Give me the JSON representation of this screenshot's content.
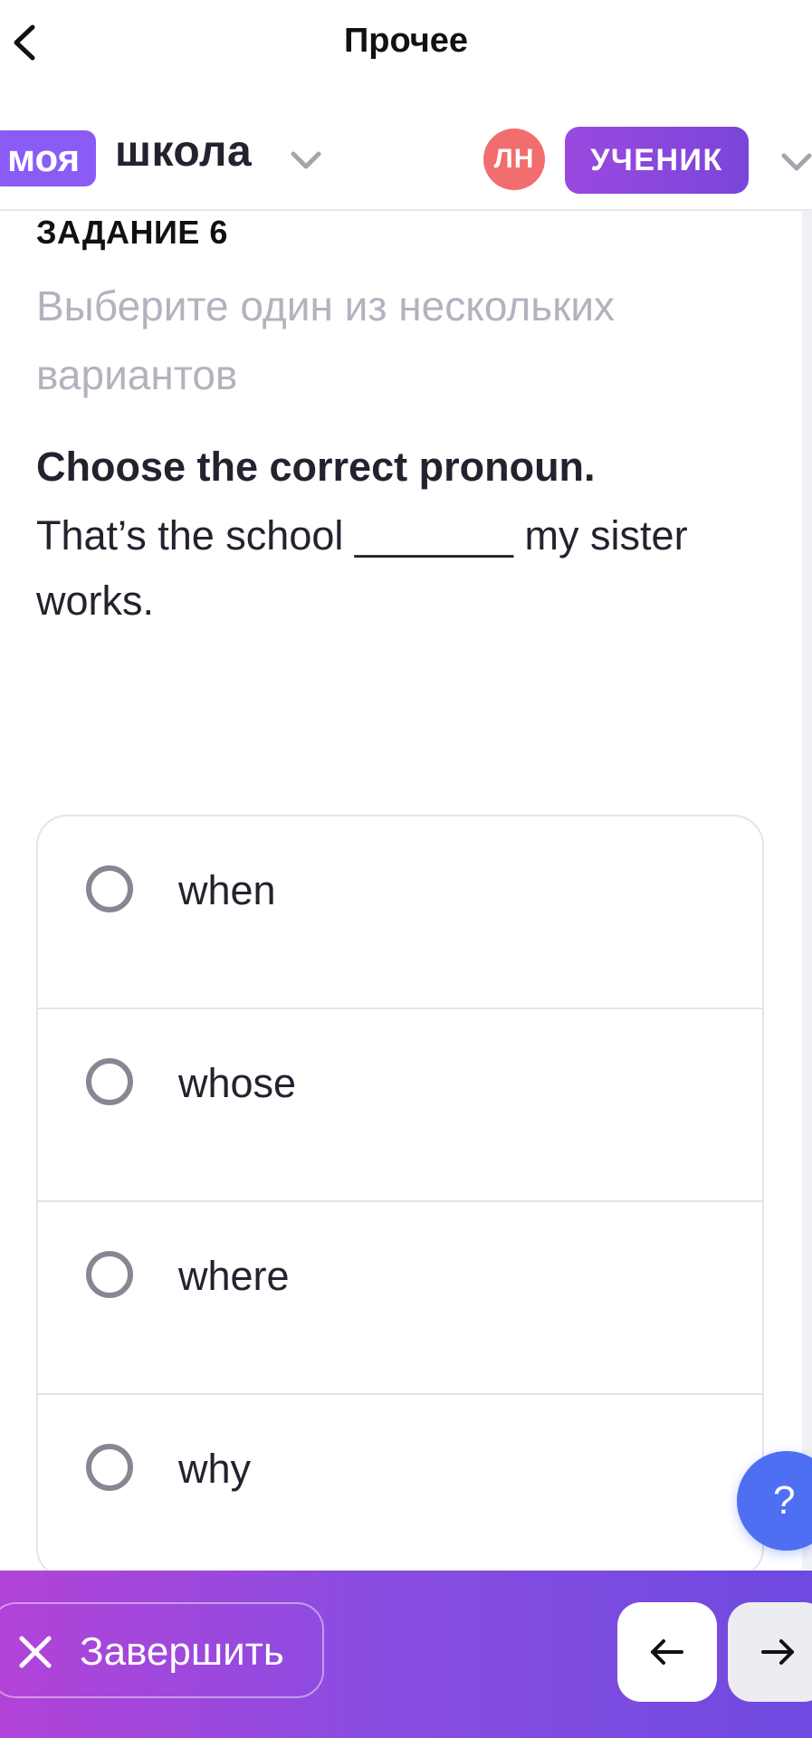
{
  "topbar": {
    "title": "Прочее"
  },
  "header": {
    "logo_chip": "моя",
    "logo_text": "школа",
    "avatar_initials": "ЛН",
    "role": "УЧЕНИК"
  },
  "task": {
    "label": "ЗАДАНИЕ 6",
    "instruction": "Выберите один из нескольких вариантов",
    "question_title": "Choose the correct pronoun.",
    "question_text": "That’s the school _______ my sister works."
  },
  "options": [
    {
      "label": "when"
    },
    {
      "label": "whose"
    },
    {
      "label": "where"
    },
    {
      "label": "why"
    }
  ],
  "help": {
    "label": "?"
  },
  "bottom": {
    "finish_label": "Завершить"
  },
  "icons": {
    "back": "chevron-left-icon",
    "school_dropdown": "chevron-down-icon",
    "role_dropdown": "chevron-down-icon",
    "finish": "close-icon",
    "prev": "arrow-left-icon",
    "next": "arrow-right-icon"
  },
  "colors": {
    "accent_purple": "#8a5cf5",
    "avatar_red": "#f26d6d",
    "help_blue": "#4f6ff2",
    "bar_gradient_start": "#b243d8",
    "bar_gradient_end": "#6e4ae0"
  }
}
